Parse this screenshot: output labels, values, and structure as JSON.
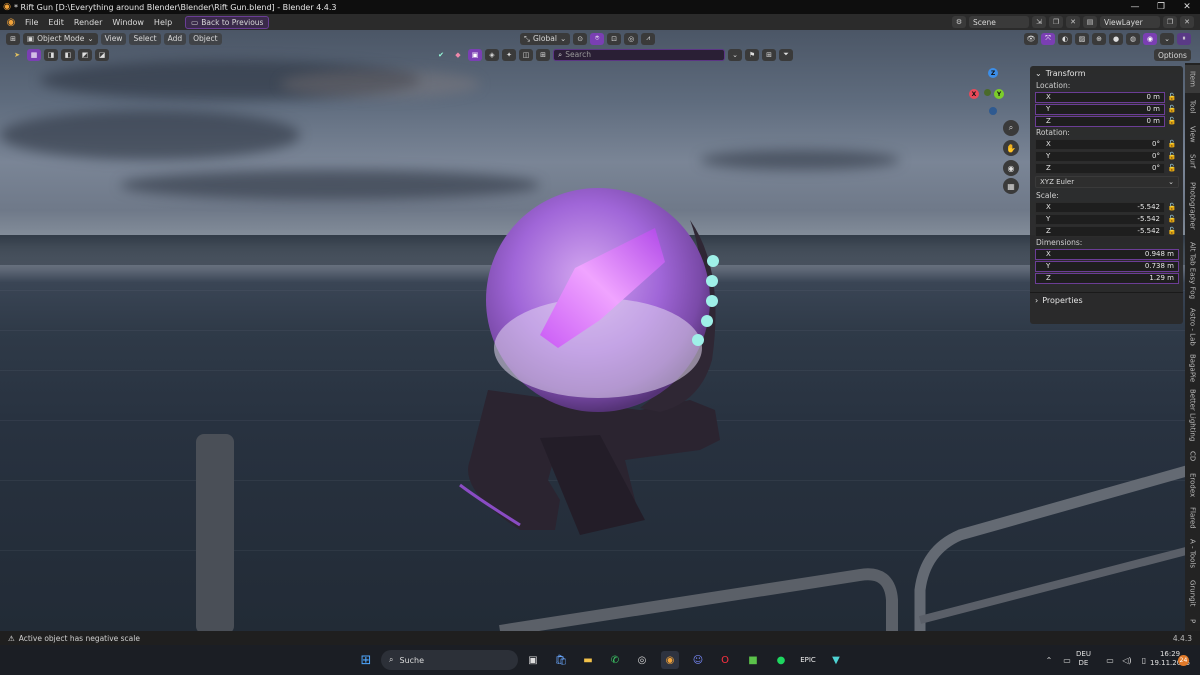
{
  "window": {
    "title": "* Rift Gun [D:\\Everything around Blender\\Blender\\Rift Gun.blend] - Blender 4.4.3",
    "minimize_icon": "minimize-icon",
    "maximize_icon": "maximize-icon",
    "close_icon": "close-icon"
  },
  "menu": {
    "items": [
      "File",
      "Edit",
      "Render",
      "Window",
      "Help"
    ],
    "back_button": "Back to Previous",
    "scene": "Scene",
    "view_layer": "ViewLayer"
  },
  "viewport_header": {
    "mode": "Object Mode",
    "menus": [
      "View",
      "Select",
      "Add",
      "Object"
    ],
    "transform_orientation": "Global",
    "search_placeholder": "Search",
    "options": "Options"
  },
  "gizmo": {
    "x": "X",
    "y": "Y",
    "z": "Z"
  },
  "npanel": {
    "transform_title": "Transform",
    "location_label": "Location:",
    "location": {
      "x": "0 m",
      "y": "0 m",
      "z": "0 m"
    },
    "rotation_label": "Rotation:",
    "rotation": {
      "x": "0°",
      "y": "0°",
      "z": "0°"
    },
    "rotation_mode": "XYZ Euler",
    "scale_label": "Scale:",
    "scale": {
      "x": "-5.542",
      "y": "-5.542",
      "z": "-5.542"
    },
    "dimensions_label": "Dimensions:",
    "dimensions": {
      "x": "0.948 m",
      "y": "0.738 m",
      "z": "1.29 m"
    },
    "axis_x": "X",
    "axis_y": "Y",
    "axis_z": "Z",
    "properties_title": "Properties"
  },
  "side_tabs": [
    "Item",
    "Tool",
    "View",
    "Surf",
    "Photographer",
    "Alt Tab Easy Fog",
    "Astro - Lab",
    "BagaPie",
    "Better Lighting",
    "CD",
    "Erodex",
    "Flared",
    "A - Tools",
    "Grungit",
    "P"
  ],
  "status": {
    "message": "Active object has negative scale",
    "version": "4.4.3"
  },
  "taskbar": {
    "search_label": "Suche",
    "language_top": "DEU",
    "language_bottom": "DE",
    "time": "16:29",
    "date": "19.11.2025",
    "notification_count": "24"
  },
  "colors": {
    "accent": "#7a3fb3",
    "orb_glow": "#c98bff",
    "crystal": "#d066ff",
    "led": "#9ff0e8"
  }
}
